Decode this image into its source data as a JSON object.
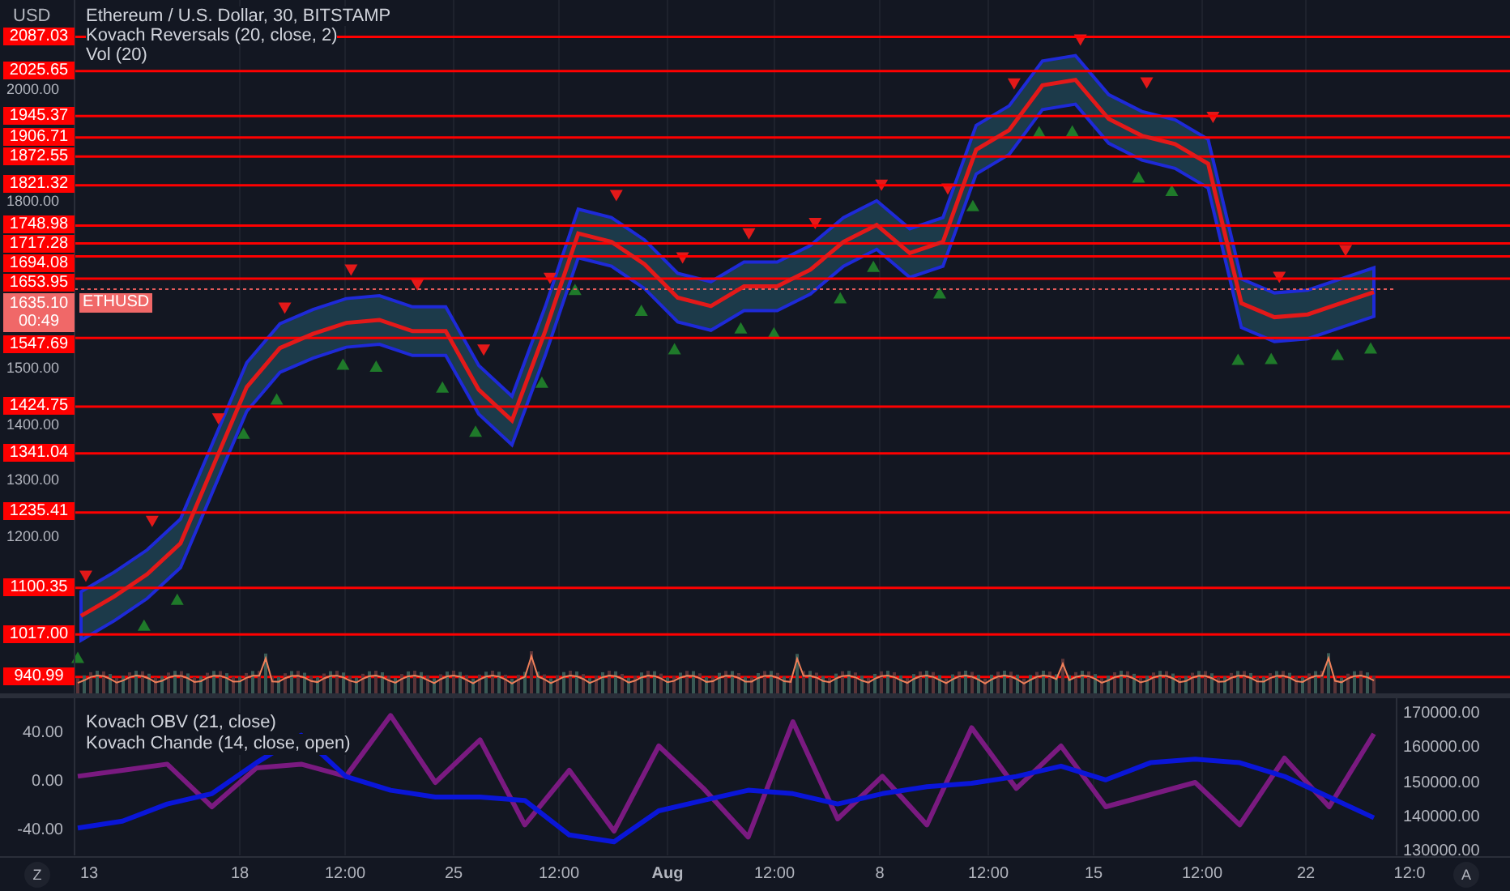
{
  "currency": "USD",
  "legend": [
    "Ethereum / U.S. Dollar, 30, BITSTAMP",
    "Kovach Reversals (20, close, 2)",
    "Vol (20)"
  ],
  "price_chart": {
    "chart_data": {
      "type": "line",
      "ylim": [
        910,
        2153
      ],
      "yticks": [
        {
          "value": 2000,
          "label": "2000.00"
        },
        {
          "value": 1800,
          "label": "1800.00"
        },
        {
          "value": 1500,
          "label": "1500.00"
        },
        {
          "value": 1400,
          "label": "1400.00"
        },
        {
          "value": 1300,
          "label": "1300.00"
        },
        {
          "value": 1200,
          "label": "1200.00"
        }
      ],
      "series": [
        {
          "color": "#e31919",
          "values": [
            1050,
            1085,
            1125,
            1180,
            1320,
            1460,
            1530,
            1555,
            1575,
            1580,
            1560,
            1560,
            1455,
            1400,
            1560,
            1735,
            1720,
            1680,
            1620,
            1605,
            1640,
            1640,
            1670,
            1720,
            1750,
            1700,
            1720,
            1885,
            1920,
            2000,
            2010,
            1940,
            1910,
            1895,
            1860,
            1610,
            1585,
            1590,
            1610,
            1630
          ]
        }
      ]
    }
  },
  "levels": [
    {
      "label": "2087.03"
    },
    {
      "label": "2025.65"
    },
    {
      "label": "1945.37"
    },
    {
      "label": "1906.71"
    },
    {
      "label": "1872.55"
    },
    {
      "label": "1821.32"
    },
    {
      "label": "1748.98"
    },
    {
      "label": "1717.28"
    },
    {
      "label": "1694.08"
    },
    {
      "label": "1653.95"
    },
    {
      "label": "1547.69"
    },
    {
      "label": "1424.75"
    },
    {
      "label": "1341.04"
    },
    {
      "label": "1235.41"
    },
    {
      "label": "1100.35"
    },
    {
      "label": "1017.00"
    },
    {
      "label": "940.99"
    }
  ],
  "last_price": {
    "price": "1635.10",
    "countdown": "00:49",
    "symbol": "ETHUSD"
  },
  "lower_pane": {
    "legend": [
      "Kovach OBV (21, close)",
      "Kovach Chande (14, close, open)"
    ],
    "chande": {
      "chart_data": {
        "type": "line",
        "ylim": [
          -60,
          69.3
        ],
        "yticks": [
          {
            "value": 40,
            "label": "40.00"
          },
          {
            "value": 0,
            "label": "0.00"
          },
          {
            "value": -40,
            "label": "-40.00"
          }
        ],
        "series": [
          {
            "color": "#7a1a80",
            "values": [
              5,
              10,
              15,
              -20,
              12,
              15,
              5,
              55,
              0,
              35,
              -35,
              10,
              -40,
              30,
              -5,
              -45,
              50,
              -30,
              5,
              -35,
              45,
              -5,
              30,
              -20,
              -10,
              0,
              -35,
              20,
              -20,
              40
            ]
          }
        ]
      }
    },
    "obv": {
      "chart_data": {
        "type": "line",
        "ylim": [
          129059,
          174706
        ],
        "yticks": [
          {
            "value": 170000,
            "label": "170000.00"
          },
          {
            "value": 160000,
            "label": "160000.00"
          },
          {
            "value": 150000,
            "label": "150000.00"
          },
          {
            "value": 140000,
            "label": "140000.00"
          },
          {
            "value": 130000,
            "label": "130000.00"
          }
        ],
        "series": [
          {
            "color": "#0a16d8",
            "values": [
              137000,
              139000,
              144000,
              147000,
              156000,
              164000,
              152000,
              148000,
              146000,
              146000,
              145000,
              135000,
              133000,
              142000,
              145000,
              148000,
              147000,
              144000,
              147000,
              149000,
              150000,
              152000,
              155000,
              151000,
              156000,
              157000,
              156000,
              152000,
              146000,
              140000
            ]
          }
        ]
      }
    }
  },
  "time_axis": [
    "13",
    "18",
    "12:00",
    "25",
    "12:00",
    "Aug",
    "12:00",
    "8",
    "12:00",
    "15",
    "12:00",
    "22",
    "12:0"
  ],
  "buttons": {
    "left": "Z",
    "right": "A"
  }
}
